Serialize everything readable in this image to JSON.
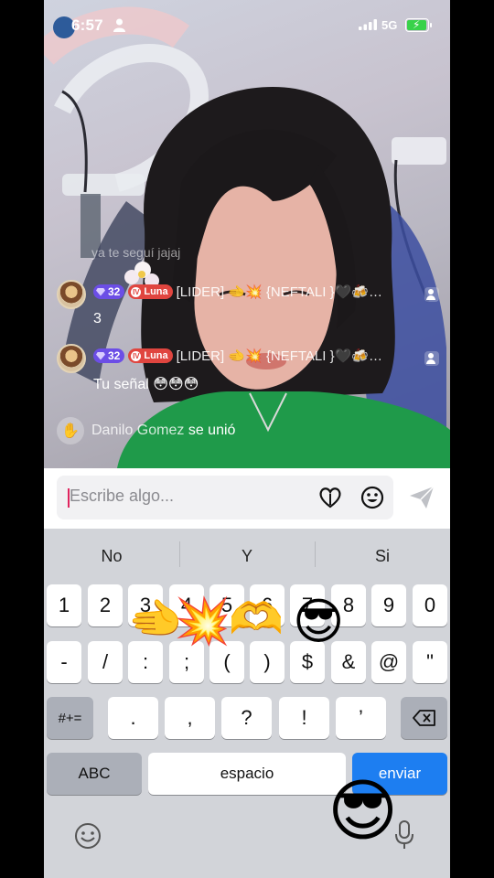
{
  "status_bar": {
    "time": "6:57",
    "network": "5G"
  },
  "chat": {
    "faded_line": "ya te seguí jajaj",
    "messages": [
      {
        "level": "32",
        "fan_label": "Luna",
        "fan_level": "IV",
        "username": "[LIDER] 🫲💥 {NEFTALI }🖤🍻…",
        "text": "3"
      },
      {
        "level": "32",
        "fan_label": "Luna",
        "fan_level": "IV",
        "username": "[LIDER] 🫲💥 {NEFTALI }🖤🍻…",
        "text": "Tu señal 😳😳😳"
      }
    ],
    "join": {
      "name": "Danilo Gomez",
      "action": "se unió"
    }
  },
  "input": {
    "placeholder": "Escribe algo...",
    "value": ""
  },
  "keyboard": {
    "suggestions": [
      "No",
      "Y",
      "Si"
    ],
    "row1": [
      "1",
      "2",
      "3",
      "4",
      "5",
      "6",
      "7",
      "8",
      "9",
      "0"
    ],
    "row2": [
      "-",
      "/",
      ":",
      ";",
      "(",
      ")",
      "$",
      "&",
      "@",
      "\""
    ],
    "row3_left": "#+=",
    "row3": [
      ".",
      ",",
      "?",
      "!",
      "’"
    ],
    "abc": "ABC",
    "space": "espacio",
    "send": "enviar"
  },
  "floating_emojis": [
    "🫲",
    "💥",
    "🫶",
    "😎",
    "😎"
  ],
  "colors": {
    "send_key": "#1d7ef1",
    "caret": "#e0245e",
    "level_badge": "#6c4ee6",
    "fan_badge": "#e0453f",
    "sweater": "#1f9a4a"
  }
}
